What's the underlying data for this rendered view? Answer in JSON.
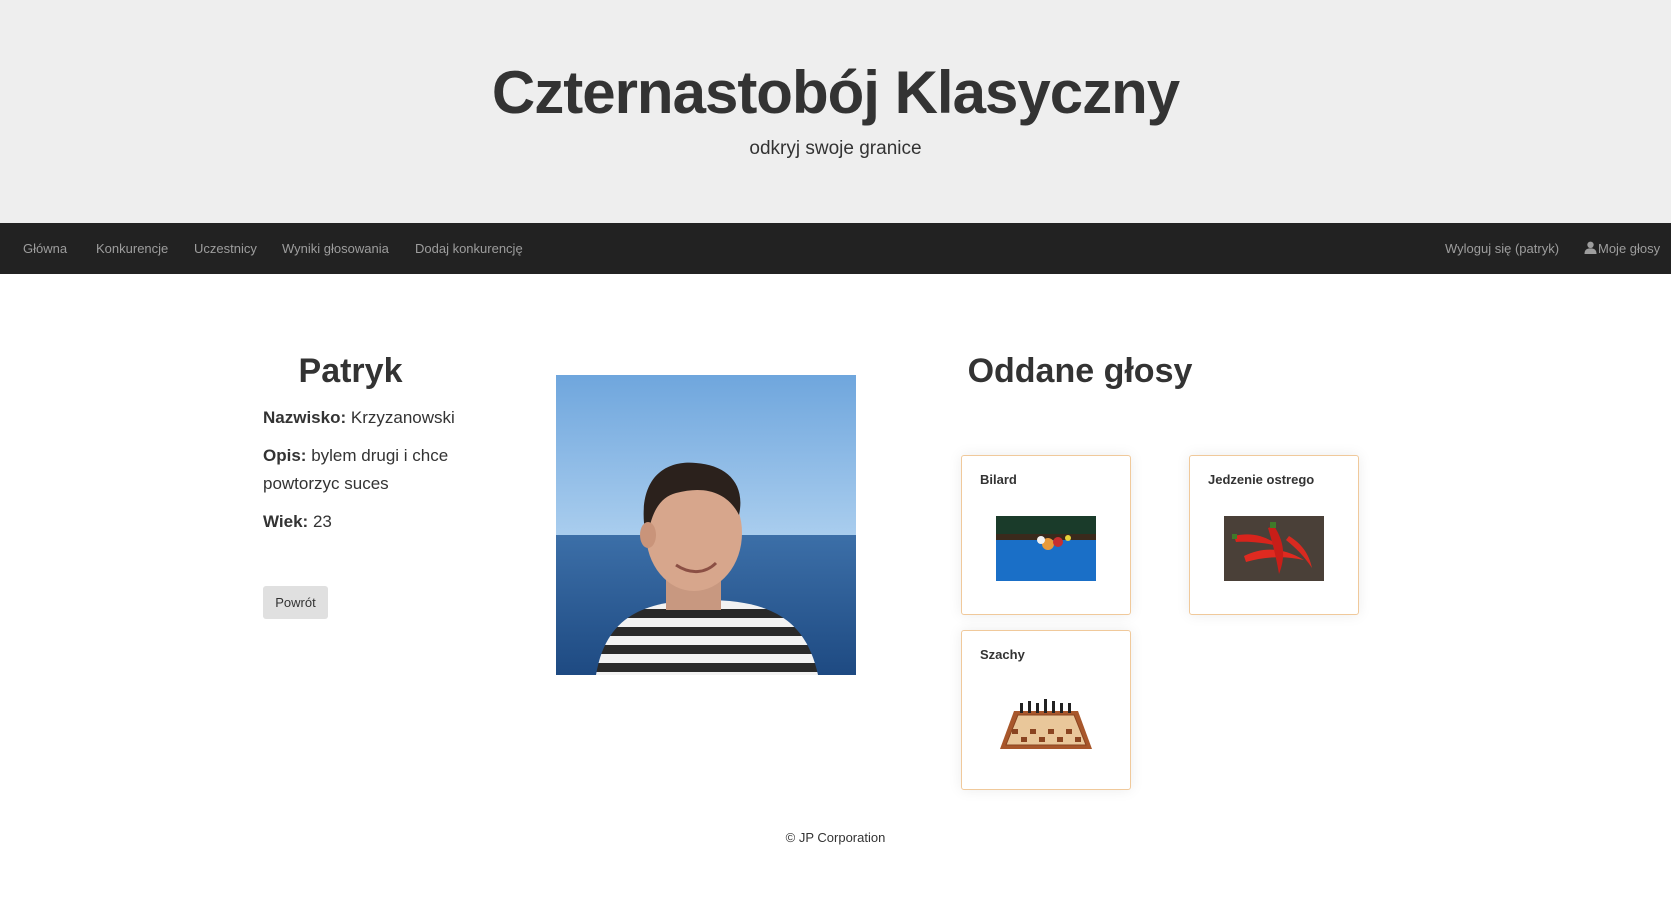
{
  "header": {
    "title": "Czternastobój Klasyczny",
    "subtitle": "odkryj swoje granice"
  },
  "nav": {
    "left": [
      "Główna",
      "Konkurencje",
      "Uczestnicy",
      "Wyniki głosowania",
      "Dodaj konkurencję"
    ],
    "logout": "Wyloguj się (patryk)",
    "my_votes": "Moje głosy",
    "my_votes_icon": "user-icon"
  },
  "profile": {
    "name": "Patryk",
    "surname_label": "Nazwisko:",
    "surname": "Krzyzanowski",
    "description_label": "Opis:",
    "description": "bylem drugi i chce powtorzyc suces",
    "age_label": "Wiek:",
    "age": "23",
    "back_label": "Powrót"
  },
  "votes": {
    "title": "Oddane głosy",
    "items": [
      {
        "name": "Bilard",
        "image": "billiards-image"
      },
      {
        "name": "Jedzenie ostrego",
        "image": "chili-peppers-image"
      },
      {
        "name": "Szachy",
        "image": "chessboard-image"
      }
    ]
  },
  "footer": {
    "text": "© JP Corporation"
  },
  "colors": {
    "jumbotron_bg": "#eeeeee",
    "navbar_bg": "#222222",
    "nav_text": "#9d9d9d",
    "card_border": "#f0c99b"
  }
}
